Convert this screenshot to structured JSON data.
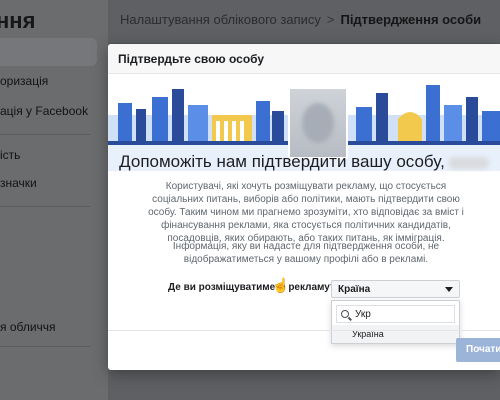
{
  "sidebar": {
    "title": "ння",
    "items": [
      {
        "label": "оризація"
      },
      {
        "label": "ація у Facebook"
      },
      {
        "label": "ість"
      },
      {
        "label": "значки"
      },
      {
        "label": "я обличчя"
      }
    ]
  },
  "breadcrumb": {
    "parent": "Налаштування облікового запису",
    "separator": ">",
    "current": "Підтвердження особи"
  },
  "modal": {
    "title": "Підтвердьте свою особу",
    "headline": "Допоможіть нам підтвердити вашу особу,",
    "paragraph1": "Користувачі, які хочуть розміщувати рекламу, що стосується соціальних питань, виборів або політики, мають підтвердити свою особу. Таким чином ми прагнемо зрозуміти, хто відповідає за вміст і фінансування реклами, яка стосується політичних кандидатів, посадовців, яких обирають, або таких питань, як імміграція.",
    "paragraph2": "Інформація, яку ви надасте для підтвердження особи, не відображатиметься у вашому профілі або в рекламі.",
    "question": "Де ви розміщуватимете рекламу?",
    "country_select": {
      "value": "Країна"
    },
    "dropdown": {
      "search_value": "Укр",
      "options": [
        "Україна"
      ]
    },
    "next_button": "Почати"
  },
  "colors": {
    "sky": "#ffffff",
    "city_blue": "#3b6fd1",
    "city_dark": "#2a4a9a",
    "accent_yellow": "#f2c94c",
    "button_disabled": "#9cb4d8"
  }
}
